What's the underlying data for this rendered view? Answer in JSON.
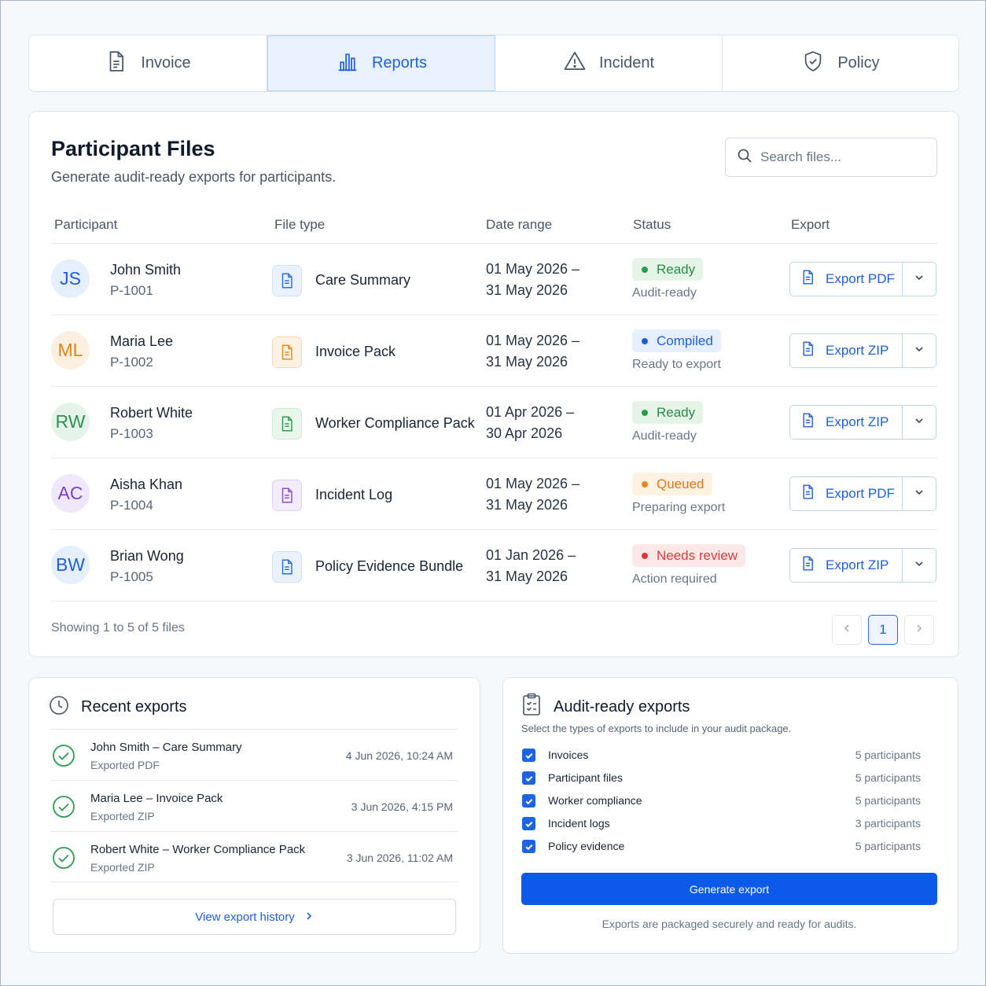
{
  "tabs": [
    {
      "label": "Invoice",
      "icon": "document-icon",
      "active": false
    },
    {
      "label": "Reports",
      "icon": "bar-chart-icon",
      "active": true
    },
    {
      "label": "Incident",
      "icon": "warning-icon",
      "active": false
    },
    {
      "label": "Policy",
      "icon": "shield-check-icon",
      "active": false
    }
  ],
  "main": {
    "title": "Participant Files",
    "subtitle": "Generate audit-ready exports for participants.",
    "search_placeholder": "Search files...",
    "columns": [
      "Participant",
      "File type",
      "Date range",
      "Status",
      "Export"
    ],
    "rows": [
      {
        "initials": "JS",
        "name": "John Smith",
        "id": "P-1001",
        "file_type": "Care Summary",
        "date_from": "01 May 2026 –",
        "date_to": "31 May 2026",
        "status": "Ready",
        "status_sub": "Audit-ready",
        "export": "Export PDF",
        "color": "#1f5fd6"
      },
      {
        "initials": "ML",
        "name": "Maria Lee",
        "id": "P-1002",
        "file_type": "Invoice Pack",
        "date_from": "01 May 2026 –",
        "date_to": "31 May 2026",
        "status": "Compiled",
        "status_sub": "Ready to export",
        "export": "Export ZIP",
        "color": "#d9851c"
      },
      {
        "initials": "RW",
        "name": "Robert White",
        "id": "P-1003",
        "file_type": "Worker Compliance Pack",
        "date_from": "01 Apr 2026 –",
        "date_to": "30 Apr 2026",
        "status": "Ready",
        "status_sub": "Audit-ready",
        "export": "Export ZIP",
        "color": "#2f9150"
      },
      {
        "initials": "AC",
        "name": "Aisha Khan",
        "id": "P-1004",
        "file_type": "Incident Log",
        "date_from": "01 May 2026 –",
        "date_to": "31 May 2026",
        "status": "Queued",
        "status_sub": "Preparing export",
        "export": "Export PDF",
        "color": "#7a42c8"
      },
      {
        "initials": "BW",
        "name": "Brian Wong",
        "id": "P-1005",
        "file_type": "Policy Evidence Bundle",
        "date_from": "01 Jan 2026 –",
        "date_to": "31 May 2026",
        "status": "Needs review",
        "status_sub": "Action required",
        "export": "Export ZIP",
        "color": "#1f5fd6"
      }
    ],
    "footer": "Showing 1 to 5 of 5 files",
    "current_page": "1"
  },
  "recent": {
    "title": "Recent exports",
    "items": [
      {
        "title": "John Smith – Care Summary",
        "sub": "Exported PDF",
        "time": "4 Jun 2026, 10:24 AM"
      },
      {
        "title": "Maria Lee – Invoice Pack",
        "sub": "Exported ZIP",
        "time": "3 Jun 2026, 4:15 PM"
      },
      {
        "title": "Robert White – Worker Compliance Pack",
        "sub": "Exported ZIP",
        "time": "3 Jun 2026, 11:02 AM"
      }
    ],
    "history_label": "View export history"
  },
  "audit": {
    "title": "Audit-ready exports",
    "description": "Select the types of exports to include in your audit package.",
    "options": [
      {
        "label": "Invoices",
        "count": "5 participants",
        "checked": true
      },
      {
        "label": "Participant files",
        "count": "5 participants",
        "checked": true
      },
      {
        "label": "Worker compliance",
        "count": "5 participants",
        "checked": true
      },
      {
        "label": "Incident logs",
        "count": "3 participants",
        "checked": true
      },
      {
        "label": "Policy evidence",
        "count": "5 participants",
        "checked": true
      }
    ],
    "button": "Generate export",
    "note": "Exports are packaged securely and ready for audits."
  },
  "colors": {
    "accent": "#1f5fd6",
    "primary_button": "#0d5ae8"
  }
}
